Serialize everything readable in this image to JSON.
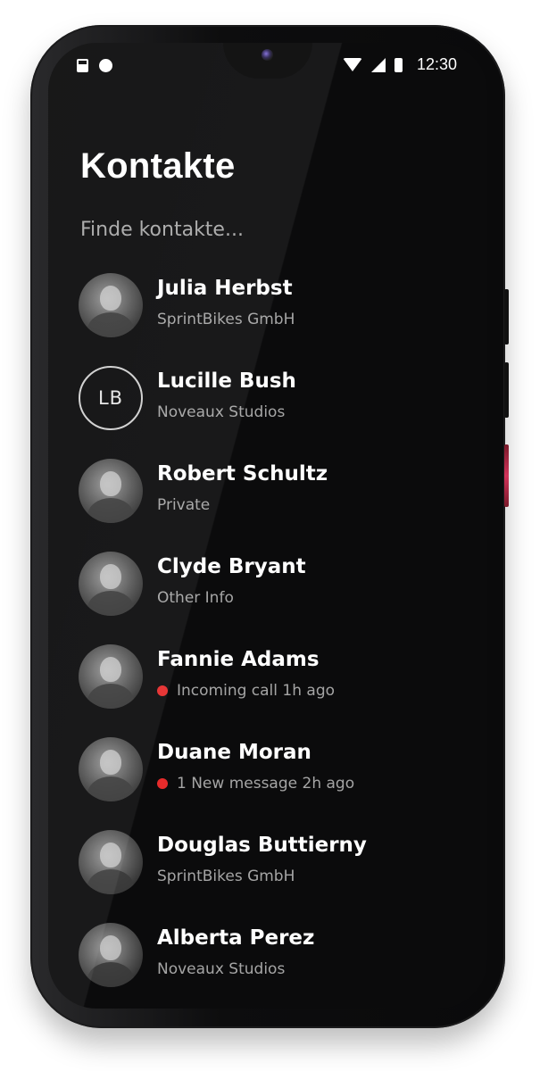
{
  "status_bar": {
    "time": "12:30",
    "icons": [
      "sim-card-icon",
      "notification-dot-icon",
      "wifi-icon",
      "signal-icon",
      "battery-icon"
    ]
  },
  "header": {
    "title": "Kontakte"
  },
  "search": {
    "placeholder": "Finde kontakte...",
    "value": ""
  },
  "colors": {
    "background": "#0b0b0c",
    "text_primary": "#ffffff",
    "text_secondary": "#a5a5a5",
    "status_red": "#e62b2b"
  },
  "contacts": [
    {
      "name": "Julia Herbst",
      "subtitle": "SprintBikes GmbH",
      "avatar": "photo",
      "initials": "",
      "status_dot": false
    },
    {
      "name": "Lucille Bush",
      "subtitle": "Noveaux Studios",
      "avatar": "initials",
      "initials": "LB",
      "status_dot": false
    },
    {
      "name": "Robert Schultz",
      "subtitle": "Private",
      "avatar": "photo",
      "initials": "",
      "status_dot": false
    },
    {
      "name": "Clyde Bryant",
      "subtitle": "Other Info",
      "avatar": "photo",
      "initials": "",
      "status_dot": false
    },
    {
      "name": "Fannie Adams",
      "subtitle": "Incoming call 1h ago",
      "avatar": "photo",
      "initials": "",
      "status_dot": true
    },
    {
      "name": "Duane Moran",
      "subtitle": "1 New message 2h ago",
      "avatar": "photo",
      "initials": "",
      "status_dot": true
    },
    {
      "name": "Douglas Buttierny",
      "subtitle": "SprintBikes GmbH",
      "avatar": "photo",
      "initials": "",
      "status_dot": false
    },
    {
      "name": "Alberta Perez",
      "subtitle": "Noveaux Studios",
      "avatar": "photo",
      "initials": "",
      "status_dot": false
    }
  ]
}
